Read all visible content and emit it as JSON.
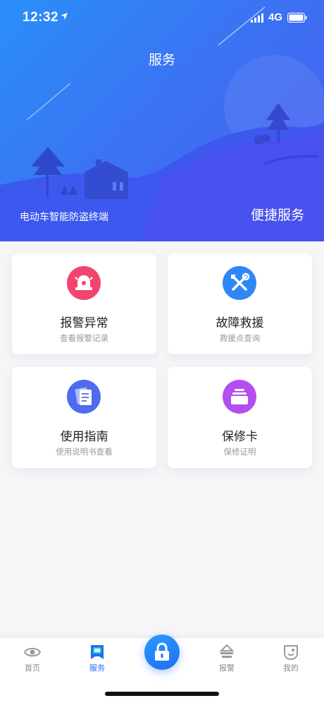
{
  "status_bar": {
    "time": "12:32",
    "network": "4G"
  },
  "header": {
    "title": "服务",
    "subtitle": "电动车智能防盗终端",
    "right_label": "便捷服务"
  },
  "cards": [
    {
      "title": "报警异常",
      "subtitle": "查看报警记录",
      "icon": "alarm-bell-icon",
      "color": "#f2456e"
    },
    {
      "title": "故障救援",
      "subtitle": "救援点查询",
      "icon": "repair-tools-icon",
      "color": "#2f86f6"
    },
    {
      "title": "使用指南",
      "subtitle": "使用说明书查看",
      "icon": "manual-icon",
      "color": "#4f6cf0"
    },
    {
      "title": "保修卡",
      "subtitle": "保修证明",
      "icon": "warranty-card-icon",
      "color": "#b44ef0"
    }
  ],
  "tabbar": {
    "items": [
      {
        "label": "首页",
        "icon": "eye-icon",
        "active": false
      },
      {
        "label": "服务",
        "icon": "service-icon",
        "active": true
      },
      {
        "label": "报警",
        "icon": "alarm-icon",
        "active": false
      },
      {
        "label": "我的",
        "icon": "profile-icon",
        "active": false
      }
    ],
    "center_icon": "lock-icon"
  },
  "colors": {
    "primary": "#1f6ef5",
    "hero_start": "#2a8ff8",
    "hero_end": "#4a5cf0"
  }
}
